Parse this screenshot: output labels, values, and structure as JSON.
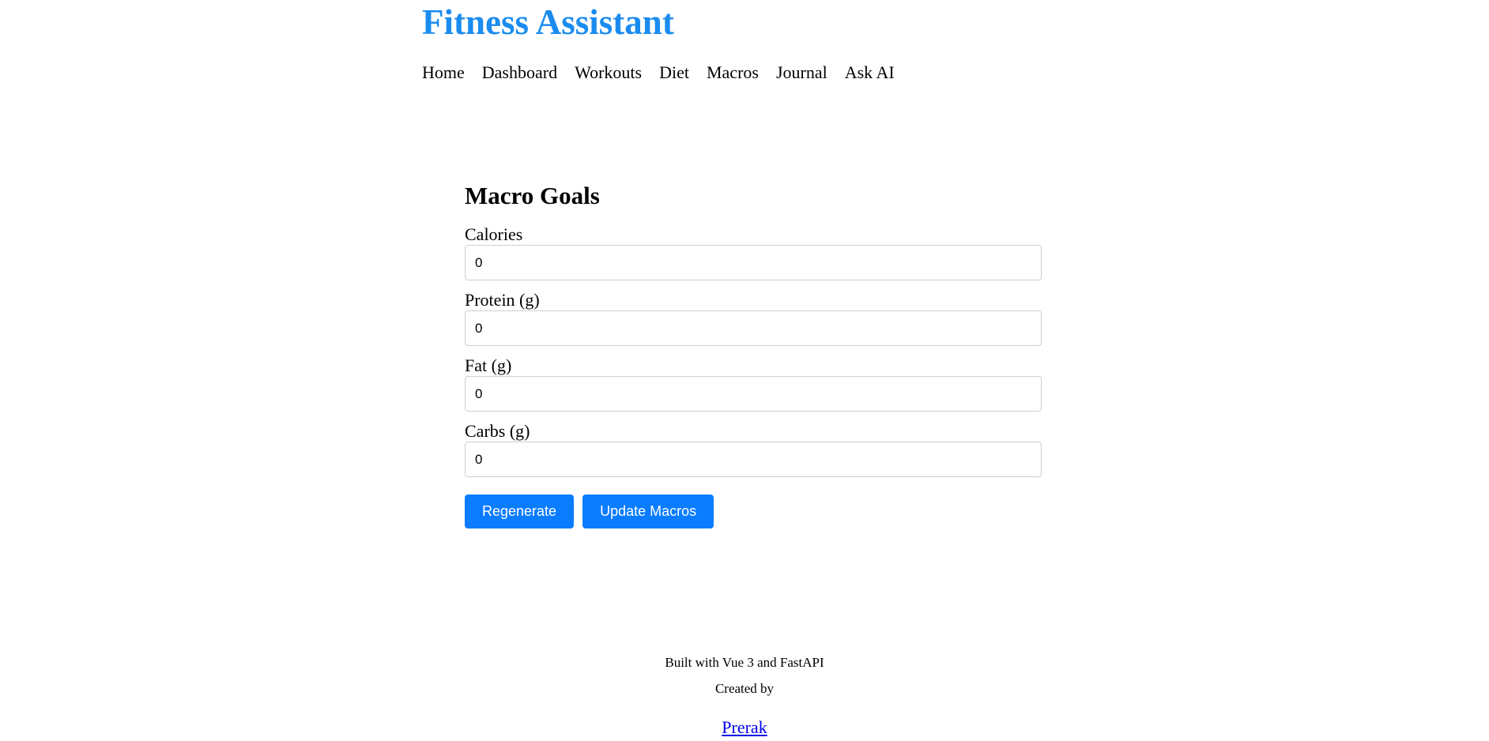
{
  "app": {
    "title": "Fitness Assistant"
  },
  "nav": {
    "items": [
      {
        "label": "Home"
      },
      {
        "label": "Dashboard"
      },
      {
        "label": "Workouts"
      },
      {
        "label": "Diet"
      },
      {
        "label": "Macros"
      },
      {
        "label": "Journal"
      },
      {
        "label": "Ask AI"
      }
    ]
  },
  "macro_goals": {
    "title": "Macro Goals",
    "fields": [
      {
        "label": "Calories",
        "value": "0"
      },
      {
        "label": "Protein (g)",
        "value": "0"
      },
      {
        "label": "Fat (g)",
        "value": "0"
      },
      {
        "label": "Carbs (g)",
        "value": "0"
      }
    ],
    "buttons": {
      "regenerate": "Regenerate",
      "update": "Update Macros"
    }
  },
  "footer": {
    "built_with": "Built with Vue 3 and FastAPI",
    "created_by": "Created by",
    "author_link": "Prerak"
  },
  "colors": {
    "brand": "#1a8cf0",
    "button": "#0a7cff",
    "link": "#0000ee"
  }
}
